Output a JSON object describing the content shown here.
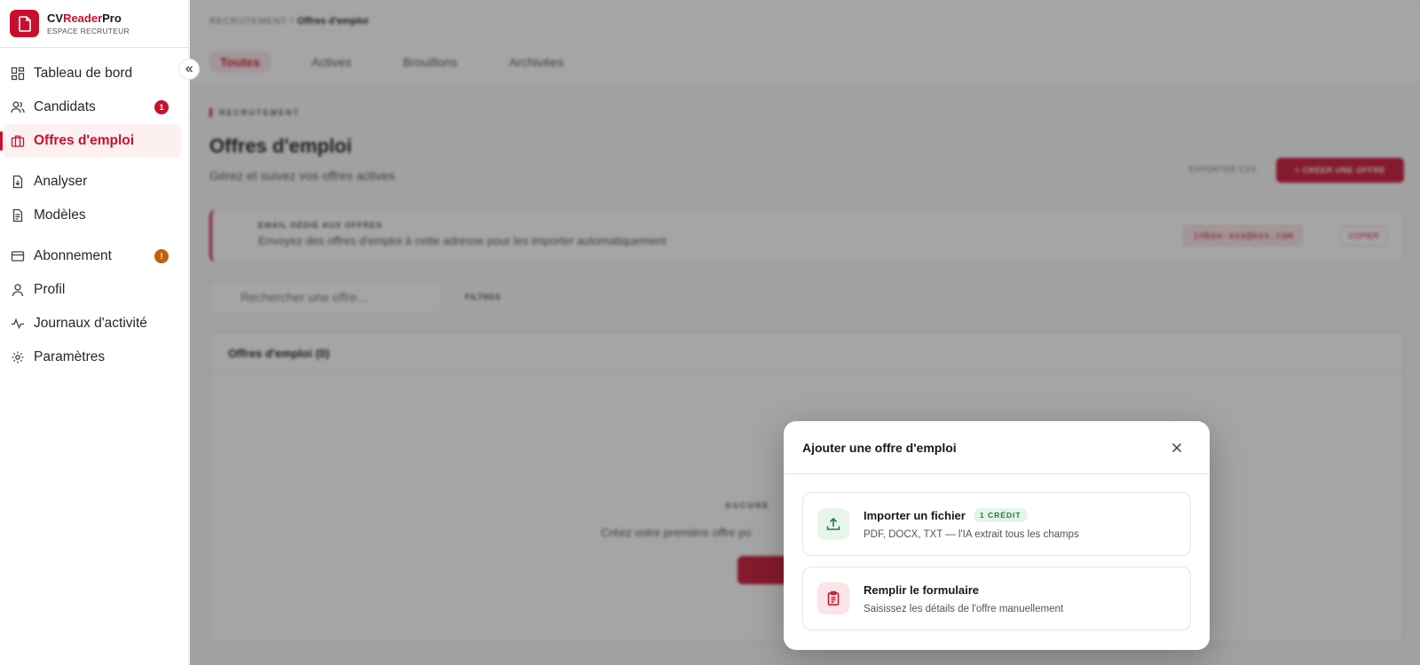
{
  "brand": {
    "name_prefix": "CV",
    "name_accent": "Reader",
    "name_suffix": "Pro",
    "subtitle": "ESPACE RECRUTEUR",
    "accent_color": "#c8102e"
  },
  "sidebar": {
    "items": [
      {
        "label": "Tableau de bord",
        "icon": "dashboard-icon"
      },
      {
        "label": "Candidats",
        "icon": "users-icon",
        "badge": "1"
      },
      {
        "label": "Offres d'emploi",
        "icon": "briefcase-icon",
        "active": true
      },
      {
        "label": "Analyser",
        "icon": "file-import-icon"
      },
      {
        "label": "Modèles",
        "icon": "document-icon"
      },
      {
        "label": "Abonnement",
        "icon": "credit-card-icon",
        "badge": "!"
      },
      {
        "label": "Profil",
        "icon": "user-icon"
      },
      {
        "label": "Journaux d'activité",
        "icon": "activity-icon"
      },
      {
        "label": "Paramètres",
        "icon": "gear-icon"
      }
    ]
  },
  "main": {
    "breadcrumb": {
      "parent": "RECRUTEMENT",
      "separator": "/",
      "current": "Offres d'emploi"
    },
    "tabs": [
      "Toutes",
      "Actives",
      "Brouillons",
      "Archivées"
    ],
    "eyebrow": "RECRUTEMENT",
    "title": "Offres d'emploi",
    "subtitle": "Gérez et suivez vos offres actives",
    "export_label": "EXPORTER CSV",
    "create_label": "+ CRÉER UNE OFFRE",
    "email_card": {
      "title": "EMAIL DÉDIÉ AUX OFFRES",
      "description": "Envoyez des offres d'emploi à cette adresse pour les importer automatiquement",
      "address": "inbox-xxx@xxx.com",
      "copy_label": "COPIER"
    },
    "search_placeholder": "Rechercher une offre...",
    "filters_label": "FILTRES",
    "list_title": "Offres d'emploi (0)",
    "empty_title": "AUCUNE",
    "empty_desc": "Créez votre première offre po"
  },
  "modal": {
    "title": "Ajouter une offre d'emploi",
    "options": [
      {
        "title": "Importer un fichier",
        "badge": "1 CRÉDIT",
        "description": "PDF, DOCX, TXT — l'IA extrait tous les champs",
        "icon": "upload-icon"
      },
      {
        "title": "Remplir le formulaire",
        "description": "Saisissez les détails de l'offre manuellement",
        "icon": "clipboard-icon"
      }
    ]
  }
}
